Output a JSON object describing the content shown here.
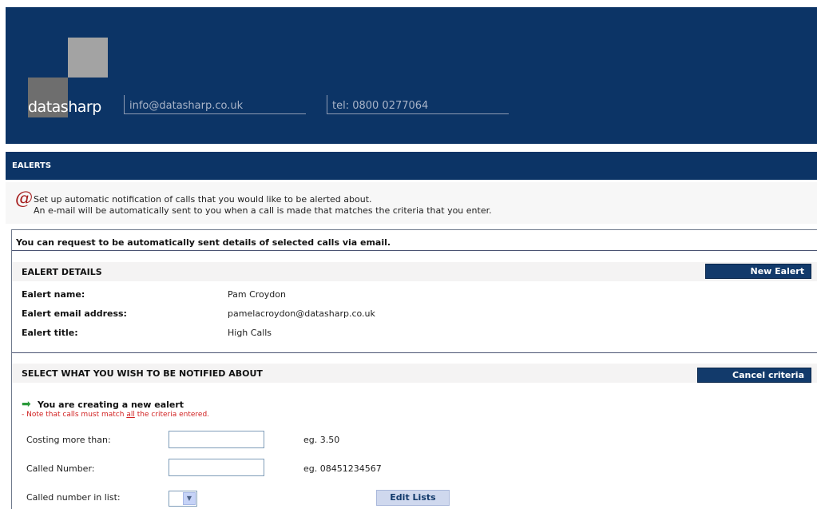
{
  "header": {
    "logo_text_part1": "data",
    "logo_text_part2": "sharp",
    "email": "info@datasharp.co.uk",
    "tel": "tel: 0800 0277064",
    "logo_colors": {
      "top_left": "#0c3466",
      "top_right": "#a3a3a3",
      "bottom_left": "#6e6e6e",
      "bottom_right": "#0c3466"
    }
  },
  "nav": {
    "title": "EALERTS"
  },
  "intro": {
    "icon": "at-icon",
    "line1": "Set up automatic notification of calls that you would like to be alerted about.",
    "line2": "An e-mail will be automatically sent to you when a call is made that matches the criteria that you enter."
  },
  "panel": {
    "title": "You can request to be automatically sent details of selected calls via email.",
    "details_section": {
      "title": "EALERT DETAILS",
      "button": "New Ealert",
      "rows": [
        {
          "label": "Ealert name:",
          "value": "Pam Croydon"
        },
        {
          "label": "Ealert email address:",
          "value": "pamelacroydon@datasharp.co.uk"
        },
        {
          "label": "Ealert title:",
          "value": "High Calls"
        }
      ]
    },
    "criteria_section": {
      "title": "SELECT WHAT YOU WISH TO BE NOTIFIED ABOUT",
      "button": "Cancel criteria",
      "notice_heading": "You are creating a new ealert",
      "note_prefix": "- Note that calls must match ",
      "note_emphasis": "all",
      "note_suffix": " the criteria entered.",
      "fields": [
        {
          "label": "Costing more than:",
          "value": "",
          "example": "eg. 3.50"
        },
        {
          "label": "Called Number:",
          "value": "",
          "example": "eg. 08451234567"
        },
        {
          "label": "Called number in list:",
          "value": ""
        }
      ],
      "edit_lists_button": "Edit Lists"
    }
  },
  "colors": {
    "brand_navy": "#0c3466",
    "note_red": "#d12222",
    "arrow_green": "#2a9a3a"
  }
}
